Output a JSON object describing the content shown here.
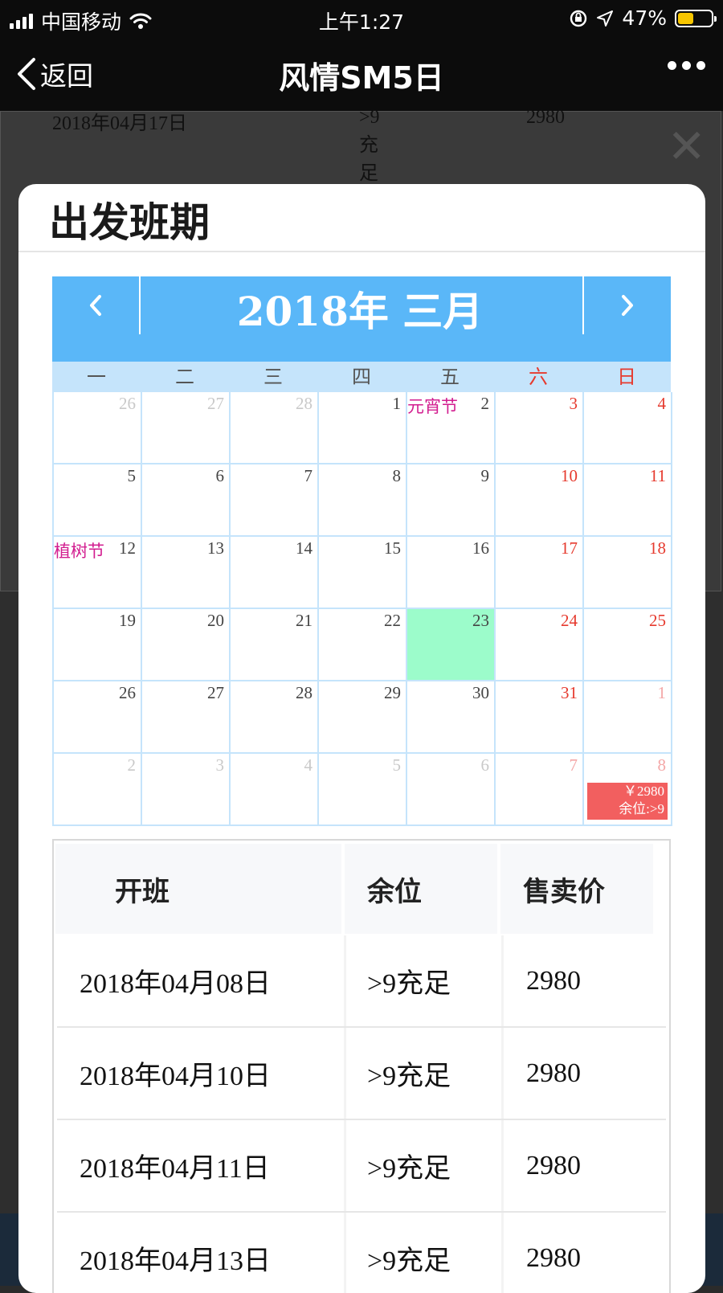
{
  "status_bar": {
    "carrier": "中国移动",
    "time": "上午1:27",
    "battery": "47%",
    "battery_level": 0.47
  },
  "nav": {
    "back_label": "返回",
    "title": "风情SM5日"
  },
  "background_rows": [
    {
      "date": "2018年04月17日",
      "seats": ">9充足",
      "price": "2980"
    }
  ],
  "modal": {
    "title": "出发班期"
  },
  "calendar": {
    "title": "2018年 三月",
    "weekdays": [
      "一",
      "二",
      "三",
      "四",
      "五",
      "六",
      "日"
    ],
    "weeks": [
      [
        {
          "day": "26",
          "other": true
        },
        {
          "day": "27",
          "other": true
        },
        {
          "day": "28",
          "other": true
        },
        {
          "day": "1"
        },
        {
          "day": "2",
          "festival": "元宵节"
        },
        {
          "day": "3"
        },
        {
          "day": "4"
        }
      ],
      [
        {
          "day": "5"
        },
        {
          "day": "6"
        },
        {
          "day": "7"
        },
        {
          "day": "8"
        },
        {
          "day": "9"
        },
        {
          "day": "10"
        },
        {
          "day": "11"
        }
      ],
      [
        {
          "day": "12",
          "festival": "植树节"
        },
        {
          "day": "13"
        },
        {
          "day": "14"
        },
        {
          "day": "15"
        },
        {
          "day": "16"
        },
        {
          "day": "17"
        },
        {
          "day": "18"
        }
      ],
      [
        {
          "day": "19"
        },
        {
          "day": "20"
        },
        {
          "day": "21"
        },
        {
          "day": "22"
        },
        {
          "day": "23",
          "today": true
        },
        {
          "day": "24"
        },
        {
          "day": "25"
        }
      ],
      [
        {
          "day": "26"
        },
        {
          "day": "27"
        },
        {
          "day": "28"
        },
        {
          "day": "29"
        },
        {
          "day": "30"
        },
        {
          "day": "31"
        },
        {
          "day": "1",
          "other": true
        }
      ],
      [
        {
          "day": "2",
          "other": true
        },
        {
          "day": "3",
          "other": true
        },
        {
          "day": "4",
          "other": true
        },
        {
          "day": "5",
          "other": true
        },
        {
          "day": "6",
          "other": true
        },
        {
          "day": "7",
          "other": true
        },
        {
          "day": "8",
          "other": true,
          "price": "￥2980",
          "seats": "余位:>9"
        }
      ]
    ]
  },
  "table": {
    "headers": [
      "开班",
      "余位",
      "售卖价"
    ],
    "rows": [
      [
        "2018年04月08日",
        ">9充足",
        "2980"
      ],
      [
        "2018年04月10日",
        ">9充足",
        "2980"
      ],
      [
        "2018年04月11日",
        ">9充足",
        "2980"
      ],
      [
        "2018年04月13日",
        ">9充足",
        "2980"
      ]
    ]
  },
  "colors": {
    "calendar_header": "#5ab7f8",
    "weekday_bar": "#c5e4fb",
    "today_cell": "#9cfccb",
    "price_tag": "#f25f5f",
    "weekend_text": "#e63a2e",
    "festival_text": "#d21c8f"
  }
}
